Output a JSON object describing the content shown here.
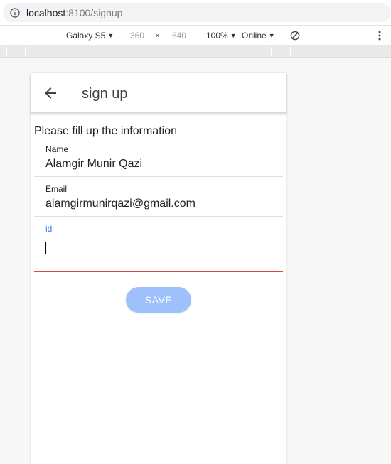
{
  "browser": {
    "url_host": "localhost",
    "url_path": ":8100/signup"
  },
  "device_toolbar": {
    "device": "Galaxy S5",
    "width": "360",
    "times": "×",
    "height": "640",
    "zoom": "100%",
    "network": "Online",
    "dropdown_caret": "▼"
  },
  "app": {
    "title": "sign up",
    "intro": "Please fill up the information",
    "fields": {
      "name": {
        "label": "Name",
        "value": "Alamgir Munir Qazi"
      },
      "email": {
        "label": "Email",
        "value": "alamgirmunirqazi@gmail.com"
      },
      "id": {
        "label": "id",
        "value": ""
      }
    },
    "save_label": "SAVE"
  },
  "colors": {
    "primary": "#3880ff",
    "primary_disabled": "#9ec1fb",
    "invalid": "#e0483c"
  }
}
